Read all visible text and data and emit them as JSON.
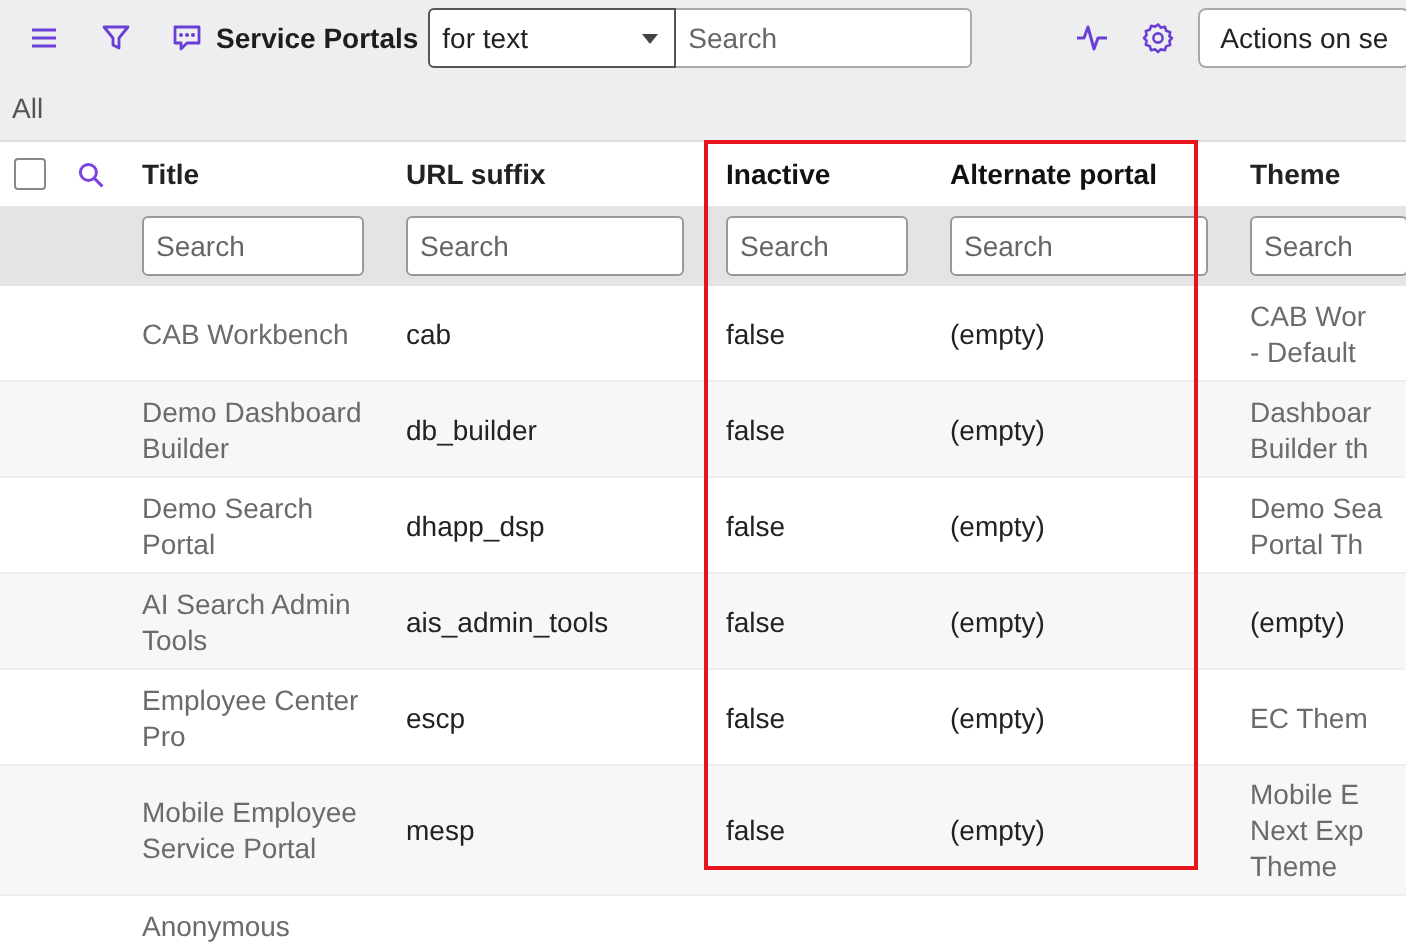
{
  "header": {
    "title": "Service Portals",
    "search_scope": "for text",
    "search": {
      "placeholder": "Search"
    },
    "actions_label": "Actions on se"
  },
  "breadcrumb": "All",
  "table": {
    "select_all_checked": false,
    "columns": [
      {
        "label": "Title",
        "search_placeholder": "Search",
        "kind": "reference",
        "highlighted": false
      },
      {
        "label": "URL suffix",
        "search_placeholder": "Search",
        "kind": "text",
        "highlighted": false
      },
      {
        "label": "Inactive",
        "search_placeholder": "Search",
        "kind": "text",
        "highlighted": true
      },
      {
        "label": "Alternate portal",
        "search_placeholder": "Search",
        "kind": "text",
        "highlighted": true
      },
      {
        "label": "Theme",
        "search_placeholder": "Search",
        "kind": "reference",
        "highlighted": false
      }
    ],
    "rows": [
      {
        "cells": [
          "CAB Workbench",
          "cab",
          "false",
          "(empty)",
          "CAB Wor\n- Default"
        ],
        "theme_empty": false
      },
      {
        "cells": [
          "Demo Dashboard\nBuilder",
          "db_builder",
          "false",
          "(empty)",
          "Dashboar\nBuilder th"
        ],
        "theme_empty": false
      },
      {
        "cells": [
          "Demo Search\nPortal",
          "dhapp_dsp",
          "false",
          "(empty)",
          "Demo Sea\nPortal Th"
        ],
        "theme_empty": false
      },
      {
        "cells": [
          "AI Search Admin\nTools",
          "ais_admin_tools",
          "false",
          "(empty)",
          "(empty)"
        ],
        "theme_empty": true
      },
      {
        "cells": [
          "Employee Center\nPro",
          "escp",
          "false",
          "(empty)",
          "EC Them"
        ],
        "theme_empty": false
      },
      {
        "cells": [
          "Mobile Employee\nService Portal",
          "mesp",
          "false",
          "(empty)",
          "Mobile E\nNext Exp\nTheme"
        ],
        "theme_empty": false
      },
      {
        "cells": [
          "Anonymous"
        ]
      }
    ]
  }
}
